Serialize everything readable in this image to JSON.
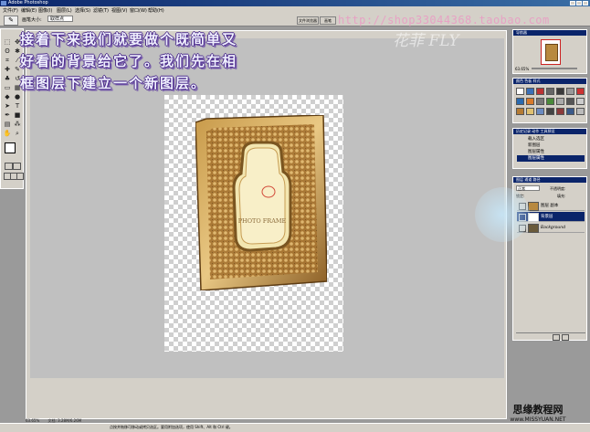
{
  "app": {
    "title": "Adobe Photoshop"
  },
  "menu": [
    "文件(F)",
    "编辑(E)",
    "图像(I)",
    "图层(L)",
    "选择(S)",
    "滤镜(T)",
    "视图(V)",
    "窗口(W)",
    "帮助(H)"
  ],
  "options": {
    "brush_label": "画笔大小:",
    "brush_value": "取样点",
    "palette_well": "文件浏览器",
    "palette_well2": "画笔"
  },
  "watermark_url": "http://shop33044368.taobao.com",
  "logo_text": "花菲 FLY",
  "caption": {
    "line1": "接着下来我们就要做个既简单又",
    "line2": "好看的背景给它了。我们先在相",
    "line3": "框图层下建立一个新图层。"
  },
  "artwork": {
    "frame_text": "PHOTO FRAME"
  },
  "status": {
    "zoom": "63.65%",
    "doc": "文档: 3.28M/6.26M"
  },
  "navigator": {
    "tab": "导航器",
    "zoom": "63.65%"
  },
  "swatches": {
    "tab": "颜色 色板 样式"
  },
  "history": {
    "tab": "历史记录 动作 工具预设",
    "items": [
      "载入选区",
      "新图层",
      "图层属性",
      "图层属性"
    ]
  },
  "layers": {
    "tab": "图层 通道 路径",
    "mode": "正常",
    "opacity_label": "不透明度:",
    "lock_label": "锁定:",
    "fill_label": "填充:",
    "rows": [
      "图层 副本",
      "背景层",
      "Background"
    ]
  },
  "taskbar": {
    "hint": "点按并拖移可移动或拷贝选区。要用附加选项，使用 Shift、Alt 和 Ctrl 键。"
  },
  "site": {
    "cn": "思缘教程网",
    "url": "www.MISSYUAN.NET"
  }
}
